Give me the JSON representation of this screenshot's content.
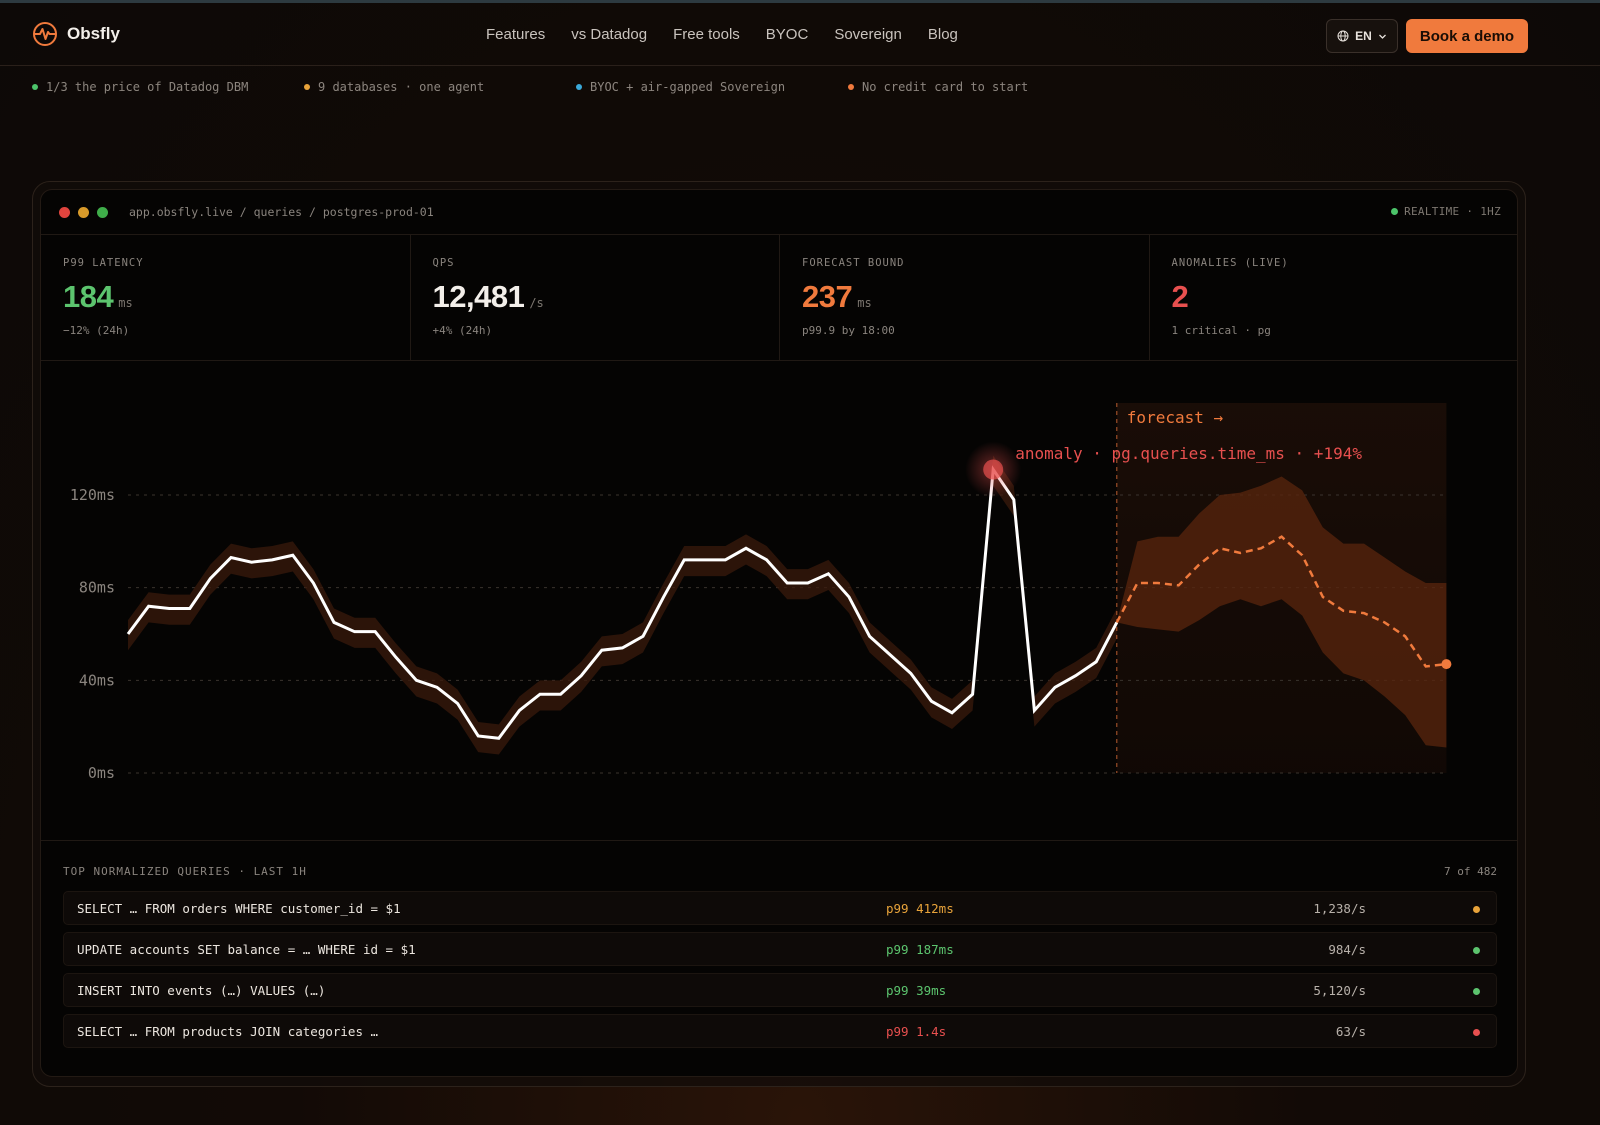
{
  "nav": {
    "brand": "Obsfly",
    "links": [
      "Features",
      "vs Datadog",
      "Free tools",
      "BYOC",
      "Sovereign",
      "Blog"
    ],
    "lang": "EN",
    "cta": "Book a demo"
  },
  "badges": [
    {
      "text": "1/3 the price of Datadog DBM",
      "color": "#4cc46a"
    },
    {
      "text": "9 databases · one agent",
      "color": "#e8a33a"
    },
    {
      "text": "BYOC + air-gapped Sovereign",
      "color": "#3aa9d9"
    },
    {
      "text": "No credit card to start",
      "color": "#f07a3d"
    }
  ],
  "window": {
    "path": "app.obsfly.live / queries / postgres-prod-01",
    "status": "REALTIME · 1HZ"
  },
  "kpis": [
    {
      "label": "P99 LATENCY",
      "value": "184",
      "unit": "ms",
      "sub": "−12% (24h)",
      "color": "#5cc46e"
    },
    {
      "label": "QPS",
      "value": "12,481",
      "unit": "/s",
      "sub": "+4% (24h)",
      "color": "#f3efea"
    },
    {
      "label": "FORECAST BOUND",
      "value": "237",
      "unit": "ms",
      "sub": "p99.9 by 18:00",
      "color": "#f07a3d"
    },
    {
      "label": "ANOMALIES (LIVE)",
      "value": "2",
      "unit": "",
      "sub": "1 critical · pg",
      "color": "#e8504f"
    }
  ],
  "chart_data": {
    "type": "line",
    "y_ticks": [
      "120ms",
      "80ms",
      "40ms",
      "0ms"
    ],
    "ylim": [
      0,
      120
    ],
    "grid": true,
    "series": [
      {
        "values": [
          60,
          72,
          71,
          71,
          84,
          93,
          91,
          92,
          94,
          82,
          65,
          61,
          61,
          50,
          40,
          37,
          30,
          16,
          15,
          27,
          34,
          34,
          42,
          53,
          54,
          59,
          76,
          92,
          92,
          92,
          97,
          92,
          82,
          82,
          86,
          76,
          59,
          51,
          43,
          31,
          26,
          34,
          131,
          118,
          27,
          37,
          42,
          48,
          65
        ]
      },
      {
        "values": [
          65,
          82,
          82,
          81,
          90,
          97,
          95,
          97,
          102,
          94,
          76,
          70,
          69,
          65,
          59,
          46,
          47
        ]
      }
    ],
    "forecast_band": {
      "upper": [
        65,
        100,
        102,
        102,
        112,
        120,
        121,
        124,
        128,
        122,
        106,
        99,
        99,
        93,
        87,
        82,
        82
      ],
      "lower": [
        65,
        63,
        62,
        61,
        66,
        72,
        75,
        72,
        75,
        68,
        52,
        43,
        40,
        33,
        25,
        12,
        11
      ]
    },
    "annotations": {
      "forecast_label": "forecast →",
      "anomaly_label": "anomaly · pg.queries.time_ms · +194%"
    },
    "colors": {
      "actual": "#ffffff",
      "forecast": "#f07a3d",
      "anomaly": "#e8504f"
    }
  },
  "queries": {
    "title": "TOP NORMALIZED QUERIES · LAST 1H",
    "count": "7 of 482",
    "rows": [
      {
        "sql": "SELECT … FROM orders WHERE customer_id = $1",
        "p99": "p99 412ms",
        "rate": "1,238/s",
        "color": "#e8a33a"
      },
      {
        "sql": "UPDATE accounts SET balance = … WHERE id = $1",
        "p99": "p99 187ms",
        "rate": "984/s",
        "color": "#5cc46e"
      },
      {
        "sql": "INSERT INTO events (…) VALUES (…)",
        "p99": "p99 39ms",
        "rate": "5,120/s",
        "color": "#5cc46e"
      },
      {
        "sql": "SELECT … FROM products JOIN categories …",
        "p99": "p99 1.4s",
        "rate": "63/s",
        "color": "#e8504f"
      }
    ]
  }
}
